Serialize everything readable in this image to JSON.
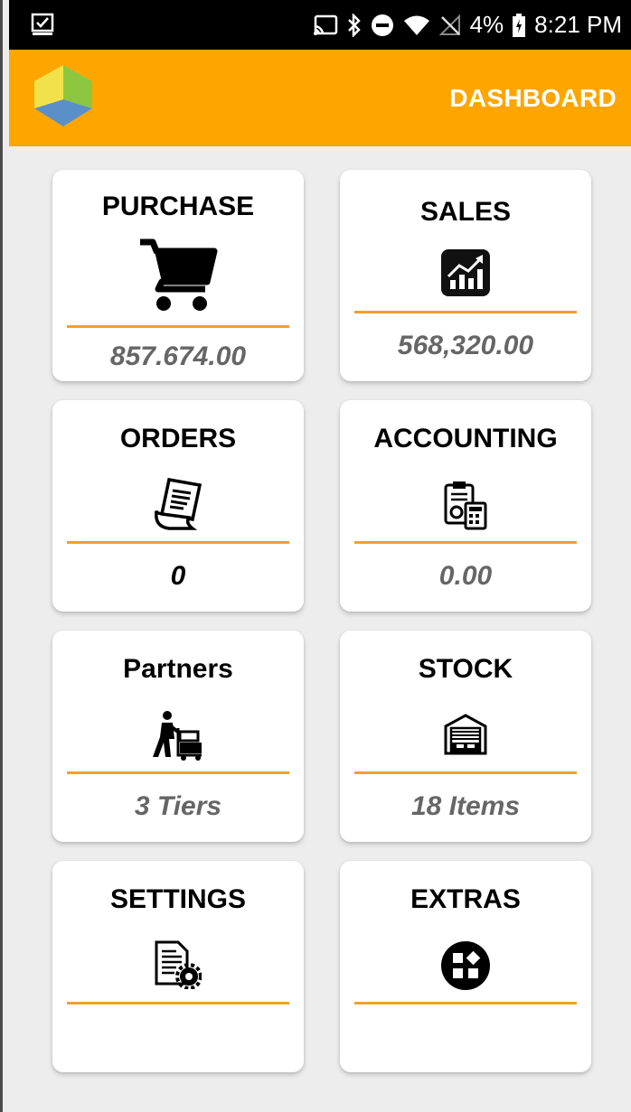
{
  "status_bar": {
    "battery": "4%",
    "time": "8:21 PM",
    "icons": [
      "checkbox-notification-icon",
      "cast-icon",
      "bluetooth-icon",
      "do-not-disturb-icon",
      "wifi-icon",
      "no-signal-icon",
      "battery-charging-icon"
    ]
  },
  "app_bar": {
    "title": "DASHBOARD",
    "logo": "app-logo-icon"
  },
  "accent_color": "#ffa500",
  "cards": [
    {
      "title": "PURCHASE",
      "icon": "shopping-cart-icon",
      "value": "857.674.00"
    },
    {
      "title": "SALES",
      "icon": "sales-chart-icon",
      "value": "568,320.00"
    },
    {
      "title": "ORDERS",
      "icon": "receipt-icon",
      "value": "0"
    },
    {
      "title": "ACCOUNTING",
      "icon": "accounting-calculator-icon",
      "value": "0.00"
    },
    {
      "title": "Partners",
      "icon": "delivery-worker-icon",
      "value": "3 Tiers"
    },
    {
      "title": "STOCK",
      "icon": "warehouse-icon",
      "value": "18 Items"
    },
    {
      "title": "SETTINGS",
      "icon": "settings-document-icon",
      "value": ""
    },
    {
      "title": "EXTRAS",
      "icon": "extras-grid-icon",
      "value": ""
    }
  ]
}
